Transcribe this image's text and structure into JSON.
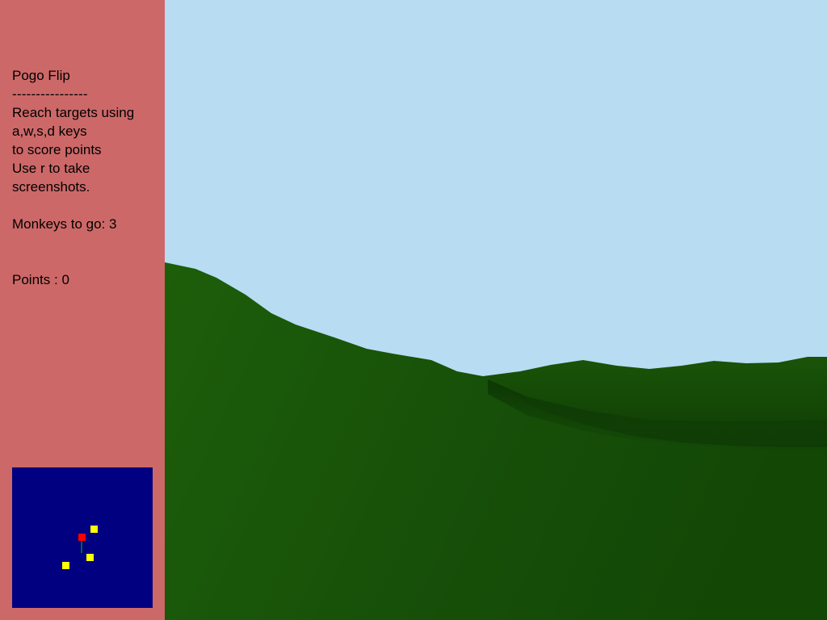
{
  "sidebar": {
    "title": "Pogo Flip",
    "divider": "----------------",
    "instructions": "Reach targets using\na,w,s,d keys\nto score points\nUse r to take\nscreenshots.",
    "monkeys_label": "Monkeys to go:",
    "monkeys_value": "3",
    "points_label": "Points :",
    "points_value": "0"
  },
  "colors": {
    "sidebar_bg": "#cd6868",
    "sky": "#b8dcf2",
    "grass": "#1c5a0a",
    "minimap_bg": "#000080",
    "target": "#ffff00",
    "player": "#ff0000",
    "heading": "#00aa00"
  },
  "minimap": {
    "player": {
      "icon": "player-marker-icon"
    },
    "targets": [
      {
        "icon": "target-marker-icon"
      },
      {
        "icon": "target-marker-icon"
      },
      {
        "icon": "target-marker-icon"
      }
    ]
  }
}
